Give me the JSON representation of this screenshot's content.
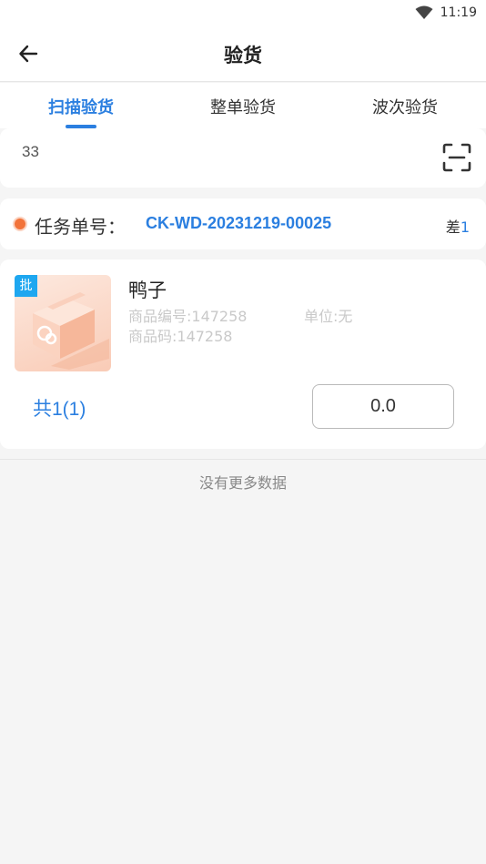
{
  "status_bar": {
    "time": "11:19",
    "wifi_icon": "wifi-icon"
  },
  "header": {
    "title": "验货",
    "back_icon": "arrow-left-icon"
  },
  "tabs": [
    {
      "label": "扫描验货",
      "active": true
    },
    {
      "label": "整单验货",
      "active": false
    },
    {
      "label": "波次验货",
      "active": false
    }
  ],
  "scan": {
    "value": "33",
    "scan_icon": "scan-frame-icon"
  },
  "task": {
    "label": "任务单号：",
    "number": "CK-WD-20231219-00025",
    "diff_label": "差",
    "diff_value": "1"
  },
  "item": {
    "badge": "批",
    "name": "鸭子",
    "code": "商品编号:147258",
    "unit": "单位:无",
    "barcode": "商品码:147258",
    "total": "共1(1)",
    "quantity": "0.0",
    "image_icon": "package-box-icon"
  },
  "footer": {
    "no_more": "没有更多数据"
  },
  "colors": {
    "accent": "#2b7fe0",
    "badge": "#1ea7f0",
    "dot": "#f2733a",
    "background": "#f5f5f5"
  }
}
